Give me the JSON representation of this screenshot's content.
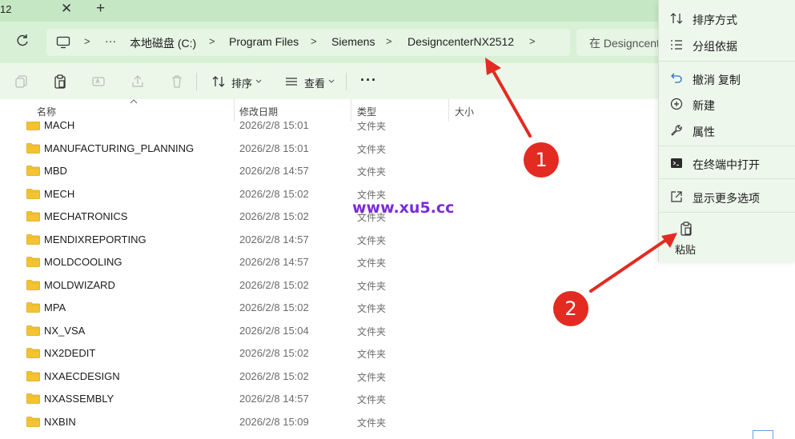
{
  "tab": {
    "title": "12",
    "close": "✕",
    "new": "+"
  },
  "breadcrumb": {
    "more": "···",
    "separator": ">",
    "items": [
      "本地磁盘 (C:)",
      "Program Files",
      "Siemens",
      "DesigncenterNX2512"
    ]
  },
  "search": {
    "placeholder": "在 Designcenter"
  },
  "toolbar": {
    "sort_label": "排序",
    "view_label": "查看",
    "more": "···"
  },
  "columns": {
    "name": "名称",
    "date": "修改日期",
    "type": "类型",
    "size": "大小"
  },
  "files": [
    {
      "name": "MACH",
      "date": "2026/2/8 15:01",
      "type": "文件夹"
    },
    {
      "name": "MANUFACTURING_PLANNING",
      "date": "2026/2/8 15:01",
      "type": "文件夹"
    },
    {
      "name": "MBD",
      "date": "2026/2/8 14:57",
      "type": "文件夹"
    },
    {
      "name": "MECH",
      "date": "2026/2/8 15:02",
      "type": "文件夹"
    },
    {
      "name": "MECHATRONICS",
      "date": "2026/2/8 15:02",
      "type": "文件夹"
    },
    {
      "name": "MENDIXREPORTING",
      "date": "2026/2/8 14:57",
      "type": "文件夹"
    },
    {
      "name": "MOLDCOOLING",
      "date": "2026/2/8 14:57",
      "type": "文件夹"
    },
    {
      "name": "MOLDWIZARD",
      "date": "2026/2/8 15:02",
      "type": "文件夹"
    },
    {
      "name": "MPA",
      "date": "2026/2/8 15:02",
      "type": "文件夹"
    },
    {
      "name": "NX_VSA",
      "date": "2026/2/8 15:04",
      "type": "文件夹"
    },
    {
      "name": "NX2DEDIT",
      "date": "2026/2/8 15:02",
      "type": "文件夹"
    },
    {
      "name": "NXAECDESIGN",
      "date": "2026/2/8 15:02",
      "type": "文件夹"
    },
    {
      "name": "NXASSEMBLY",
      "date": "2026/2/8 14:57",
      "type": "文件夹"
    },
    {
      "name": "NXBIN",
      "date": "2026/2/8 15:09",
      "type": "文件夹"
    }
  ],
  "context_menu": {
    "sort": "排序方式",
    "group": "分组依据",
    "undo": "撤消 复制",
    "new": "新建",
    "properties": "属性",
    "terminal": "在终端中打开",
    "more_options": "显示更多选项",
    "paste": "粘贴"
  },
  "watermark": "www.xu5.cc",
  "annotations": {
    "badge1": "1",
    "badge2": "2",
    "color": "#e32b22"
  },
  "colors": {
    "tabbar": "#c6e7c4",
    "addressbar": "#d8f0d6",
    "folder": "#f4c430",
    "menu_bg": "#eef7ec"
  }
}
